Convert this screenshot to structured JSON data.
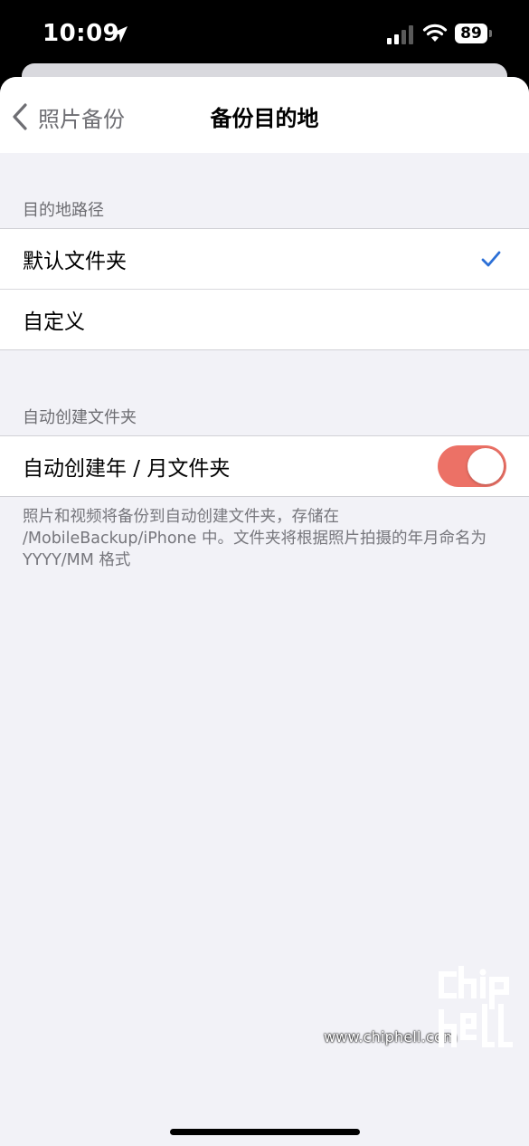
{
  "status_bar": {
    "time": "10:09",
    "battery": "89",
    "icons": [
      "location-arrow-icon",
      "cellular-signal-icon",
      "wifi-icon",
      "battery-icon"
    ]
  },
  "nav": {
    "back_label": "照片备份",
    "title": "备份目的地"
  },
  "sections": {
    "destination": {
      "header": "目的地路径",
      "options": [
        {
          "label": "默认文件夹",
          "selected": true
        },
        {
          "label": "自定义",
          "selected": false
        }
      ]
    },
    "auto_folder": {
      "header": "自动创建文件夹",
      "toggle_label": "自动创建年 / 月文件夹",
      "toggle_on": true,
      "footnote": "照片和视频将备份到自动创建文件夹，存储在 /MobileBackup/iPhone 中。文件夹将根据照片拍摄的年月命名为 YYYY/MM 格式"
    }
  },
  "watermark": {
    "url": "www.chiphell.com",
    "logo_text": "chip hell"
  },
  "colors": {
    "accent_blue": "#2b6fd6",
    "toggle_on": "#ec7166",
    "grouped_background": "#f2f2f7"
  }
}
